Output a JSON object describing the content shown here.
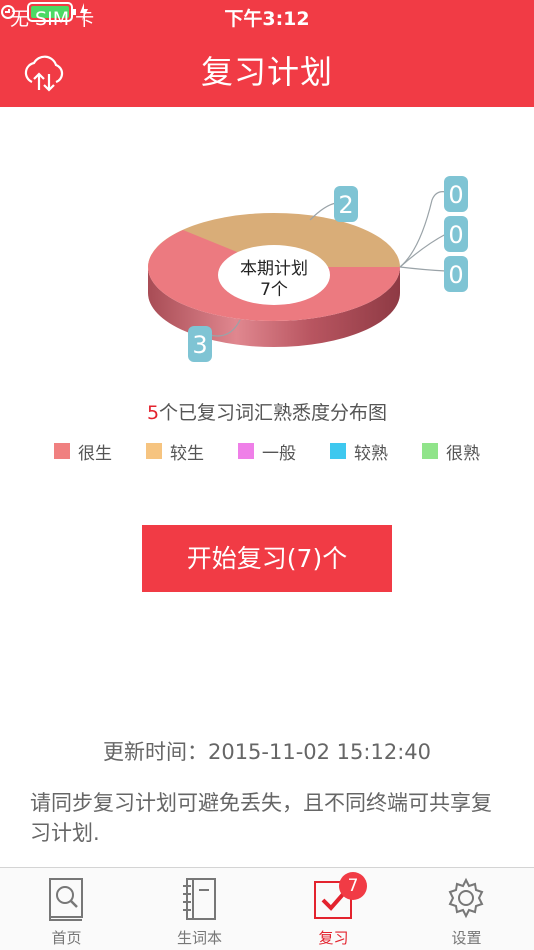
{
  "status_bar": {
    "carrier": "无 SIM 卡",
    "time": "下午3:12"
  },
  "nav": {
    "title": "复习计划",
    "left_icon": "cloud-sync-icon"
  },
  "chart_data": {
    "type": "pie",
    "center_label_line1": "本期计划",
    "center_label_line2": "7个",
    "title_number": "5",
    "title_text": "个已复习词汇熟悉度分布图",
    "categories": [
      "很生",
      "较生",
      "一般",
      "较熟",
      "很熟"
    ],
    "values": [
      3,
      2,
      0,
      0,
      0
    ],
    "colors": [
      "#f08080",
      "#f6c480",
      "#ef7fe8",
      "#3ec8ef",
      "#90e48a"
    ],
    "label_values": [
      "3",
      "2",
      "0",
      "0",
      "0"
    ]
  },
  "legend": {
    "items": [
      {
        "label": "很生",
        "color": "#f08080"
      },
      {
        "label": "较生",
        "color": "#f6c480"
      },
      {
        "label": "一般",
        "color": "#ef7fe8"
      },
      {
        "label": "较熟",
        "color": "#3ec8ef"
      },
      {
        "label": "很熟",
        "color": "#90e48a"
      }
    ]
  },
  "actions": {
    "start_review": "开始复习(7)个"
  },
  "info": {
    "update_time": "更新时间：2015-11-02 15:12:40",
    "sync_note": "请同步复习计划可避免丢失，且不同终端可共享复习计划."
  },
  "tabbar": {
    "tabs": [
      {
        "label": "首页",
        "icon": "book-search-icon"
      },
      {
        "label": "生词本",
        "icon": "notebook-icon"
      },
      {
        "label": "复习",
        "icon": "checkmark-icon",
        "badge": "7"
      },
      {
        "label": "设置",
        "icon": "gear-icon"
      }
    ]
  },
  "colors": {
    "accent": "#f13b45",
    "badge_bubble": "#7fc4d4"
  }
}
